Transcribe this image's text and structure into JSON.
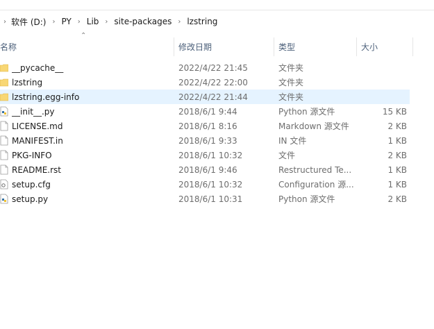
{
  "address": {
    "segments": [
      "软件 (D:)",
      "PY",
      "Lib",
      "site-packages",
      "lzstring"
    ]
  },
  "columns": {
    "name": "名称",
    "date": "修改日期",
    "type": "类型",
    "size": "大小"
  },
  "files": [
    {
      "name": "__pycache__",
      "date": "2022/4/22 21:45",
      "type": "文件夹",
      "size": "",
      "icon": "folder-icon"
    },
    {
      "name": "lzstring",
      "date": "2022/4/22 22:00",
      "type": "文件夹",
      "size": "",
      "icon": "folder-icon"
    },
    {
      "name": "lzstring.egg-info",
      "date": "2022/4/22 21:44",
      "type": "文件夹",
      "size": "",
      "icon": "folder-icon",
      "selected": true
    },
    {
      "name": "__init__.py",
      "date": "2018/6/1 9:44",
      "type": "Python 源文件",
      "size": "15 KB",
      "icon": "python-file-icon"
    },
    {
      "name": "LICENSE.md",
      "date": "2018/6/1 8:16",
      "type": "Markdown 源文件",
      "size": "2 KB",
      "icon": "file-icon"
    },
    {
      "name": "MANIFEST.in",
      "date": "2018/6/1 9:33",
      "type": "IN 文件",
      "size": "1 KB",
      "icon": "file-icon"
    },
    {
      "name": "PKG-INFO",
      "date": "2018/6/1 10:32",
      "type": "文件",
      "size": "2 KB",
      "icon": "file-icon"
    },
    {
      "name": "README.rst",
      "date": "2018/6/1 9:46",
      "type": "Restructured Te...",
      "size": "1 KB",
      "icon": "file-icon"
    },
    {
      "name": "setup.cfg",
      "date": "2018/6/1 10:32",
      "type": "Configuration 源...",
      "size": "1 KB",
      "icon": "config-file-icon"
    },
    {
      "name": "setup.py",
      "date": "2018/6/1 10:31",
      "type": "Python 源文件",
      "size": "2 KB",
      "icon": "python-file-icon"
    }
  ],
  "colors": {
    "selected_row": "#e5f3ff",
    "folder": "#f8d775",
    "header_text": "#4c607a",
    "secondary_text": "#6d6d6d"
  }
}
